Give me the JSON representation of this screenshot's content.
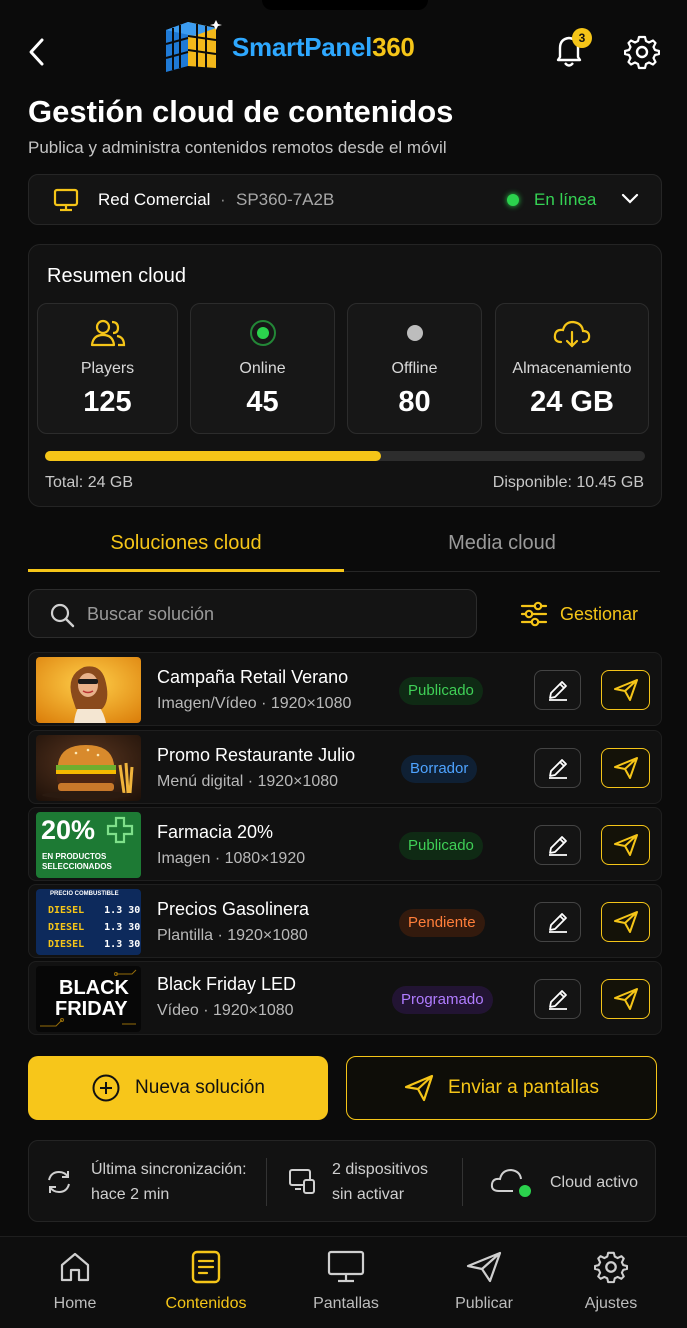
{
  "app": {
    "logo_text_a": "SmartPanel",
    "logo_text_b": "360",
    "notification_count": "3"
  },
  "header": {
    "title": "Gestión cloud de contenidos",
    "subtitle": "Publica y administra contenidos remotos desde el móvil"
  },
  "network": {
    "name": "Red Comercial",
    "separator": "·",
    "code": "SP360-7A2B",
    "status": "En línea"
  },
  "summary": {
    "title": "Resumen cloud",
    "stats": [
      {
        "label": "Players",
        "value": "125",
        "icon": "users-icon"
      },
      {
        "label": "Online",
        "value": "45",
        "icon": "online-dot-icon"
      },
      {
        "label": "Offline",
        "value": "80",
        "icon": "offline-dot-icon"
      },
      {
        "label": "Almacenamiento",
        "value": "24 GB",
        "icon": "cloud-storage-icon"
      }
    ],
    "storage_fraction": 0.56,
    "total": "Total: 24 GB",
    "available": "Disponible: 10.45 GB"
  },
  "tabs": {
    "active": "Soluciones cloud",
    "inactive": "Media cloud"
  },
  "search": {
    "placeholder": "Buscar solución",
    "value": "",
    "manage_label": "Gestionar"
  },
  "solutions": [
    {
      "title": "Campaña Retail Verano",
      "meta": "Imagen/Vídeo  ·  1920×1080",
      "status": "Publicado",
      "status_kind": "published"
    },
    {
      "title": "Promo Restaurante Julio",
      "meta": "Menú digital  ·  1920×1080",
      "status": "Borrador",
      "status_kind": "draft"
    },
    {
      "title": "Farmacia 20%",
      "meta": "Imagen  ·  1080×1920",
      "status": "Publicado",
      "status_kind": "published"
    },
    {
      "title": "Precios Gasolinera",
      "meta": "Plantilla  ·  1920×1080",
      "status": "Pendiente",
      "status_kind": "pending"
    },
    {
      "title": "Black Friday LED",
      "meta": "Vídeo  ·  1920×1080",
      "status": "Programado",
      "status_kind": "scheduled"
    }
  ],
  "thumbs": {
    "pharmacy_big": "20%",
    "pharmacy_small": "EN PRODUCTOS SELECCIONADOS",
    "fuel_header": "PRECIO COMBUSTIBLE",
    "fuel_rows": [
      {
        "name": "DIESEL",
        "price": "1.3 30"
      },
      {
        "name": "DIESEL",
        "price": "1.3 30"
      },
      {
        "name": "DIESEL",
        "price": "1.3 30"
      }
    ],
    "bf_line1": "BLACK",
    "bf_line2": "FRIDAY"
  },
  "actions": {
    "new_solution": "Nueva solución",
    "send_to_screens": "Enviar a pantallas"
  },
  "status_strip": {
    "sync_line1": "Última sincronización:",
    "sync_line2": "hace 2 min",
    "devices_line1": "2 dispositivos",
    "devices_line2": "sin activar",
    "cloud": "Cloud activo"
  },
  "nav": [
    {
      "label": "Home",
      "icon": "home-icon"
    },
    {
      "label": "Contenidos",
      "icon": "document-icon",
      "active": true
    },
    {
      "label": "Pantallas",
      "icon": "monitor-icon"
    },
    {
      "label": "Publicar",
      "icon": "paper-plane-icon"
    },
    {
      "label": "Ajustes",
      "icon": "gear-icon"
    }
  ],
  "colors": {
    "accent": "#f5c518",
    "brand_blue": "#2ea8ff",
    "online": "#2bd24d",
    "background": "#0b0b0b"
  }
}
